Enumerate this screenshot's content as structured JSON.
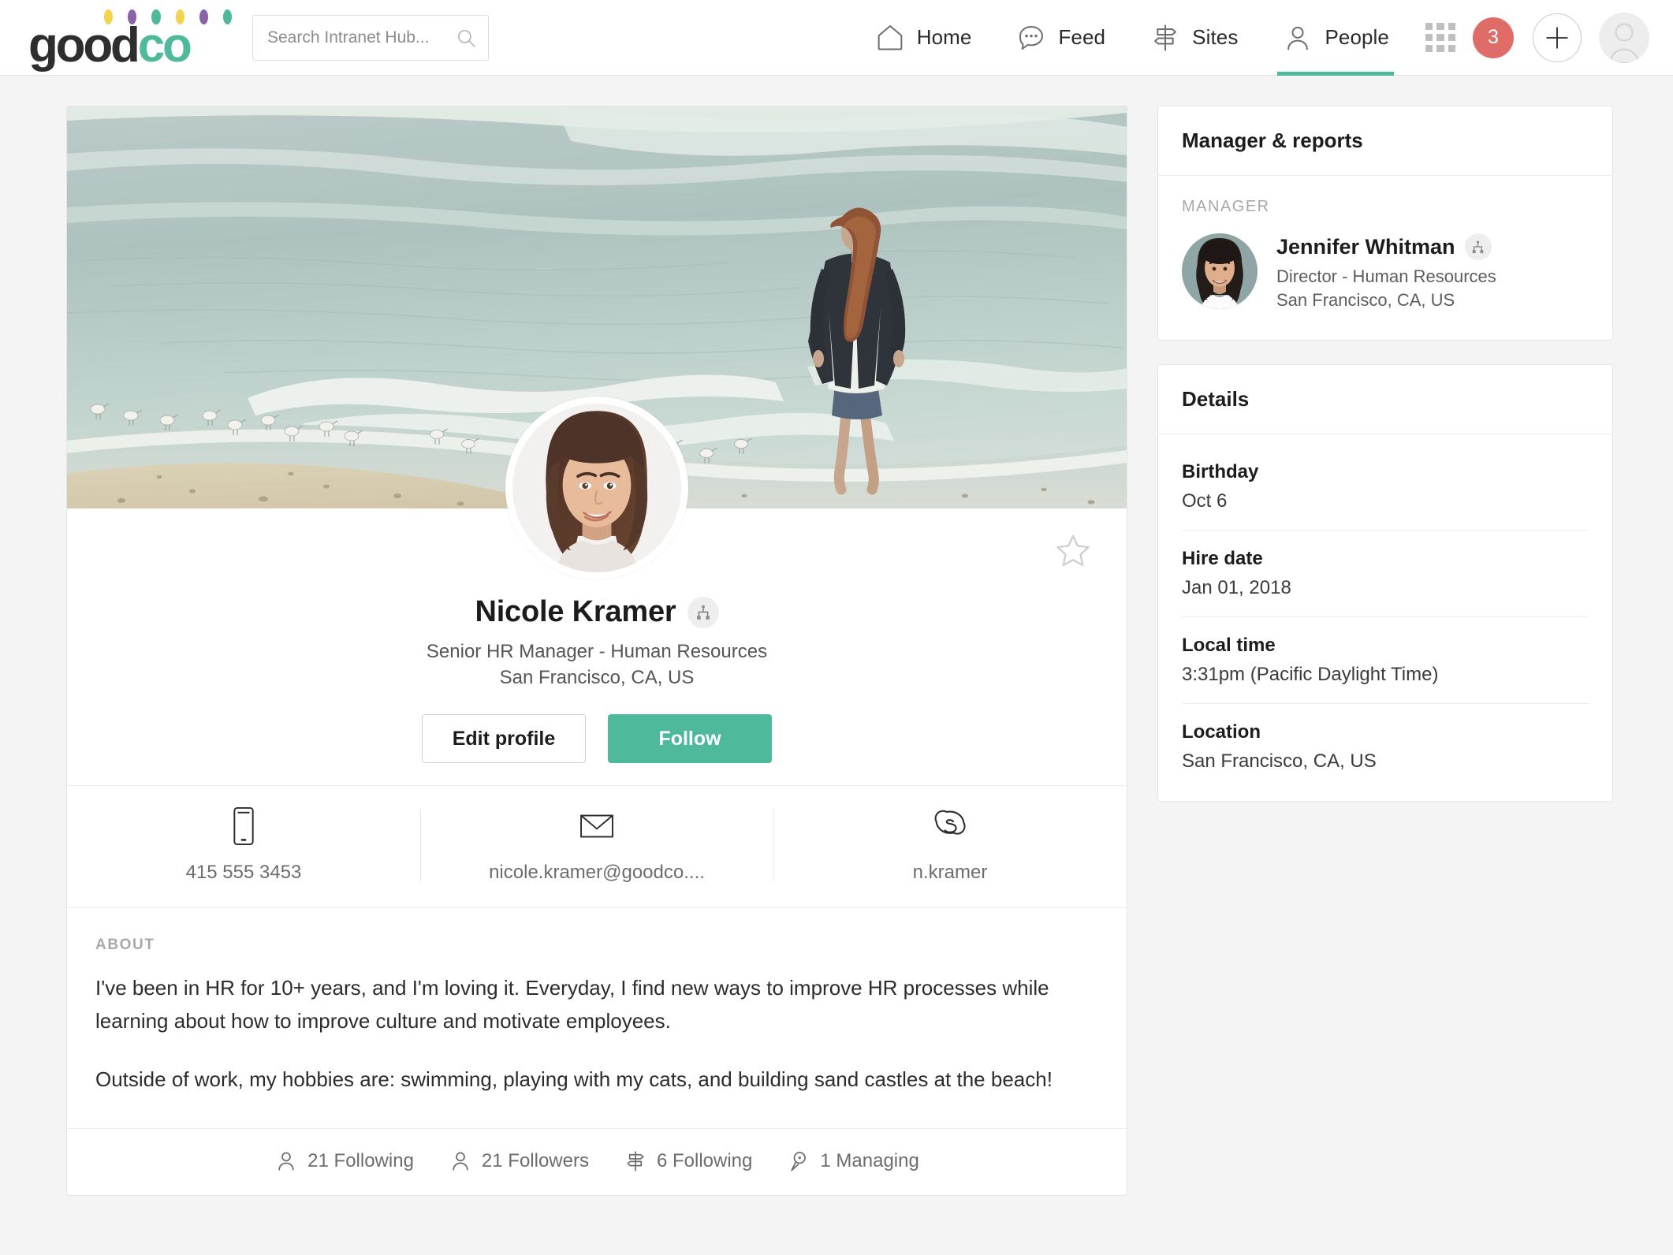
{
  "brand": {
    "name_dark": "good",
    "name_accent": "co",
    "accent_color": "#4fba9b",
    "dot_colors": [
      "#f3d44e",
      "#8b63ab",
      "#4fba9b",
      "#f3d44e",
      "#8b63ab",
      "#4fba9b"
    ]
  },
  "search": {
    "placeholder": "Search Intranet Hub...",
    "value": ""
  },
  "nav": {
    "items": [
      {
        "label": "Home",
        "icon": "home-icon",
        "active": false
      },
      {
        "label": "Feed",
        "icon": "feed-icon",
        "active": false
      },
      {
        "label": "Sites",
        "icon": "sites-icon",
        "active": false
      },
      {
        "label": "People",
        "icon": "people-icon",
        "active": true
      }
    ],
    "apps_icon": "apps-grid-icon",
    "notification_count": "3",
    "notification_color": "#e06c68",
    "create_icon": "plus-icon",
    "account_icon": "account-avatar-icon"
  },
  "profile": {
    "cover_photo_alt": "beach-cover-photo",
    "avatar_alt": "nicole-kramer-avatar",
    "name": "Nicole Kramer",
    "org_chart_icon": "org-chart-icon",
    "title": "Senior HR Manager - Human Resources",
    "location": "San Francisco, CA, US",
    "favorite_icon": "star-outline-icon",
    "buttons": {
      "edit": "Edit profile",
      "follow": "Follow"
    },
    "contacts": [
      {
        "icon": "mobile-phone-icon",
        "value": "415 555 3453"
      },
      {
        "icon": "envelope-icon",
        "value": "nicole.kramer@goodco...."
      },
      {
        "icon": "skype-icon",
        "value": "n.kramer"
      }
    ],
    "about": {
      "label": "ABOUT",
      "paragraphs": [
        "I've been in HR for 10+ years, and I'm loving it. Everyday, I find new ways to improve HR processes while learning about how to improve culture and motivate employees.",
        "Outside of work, my hobbies are: swimming, playing with my cats, and building sand castles at the beach!"
      ]
    },
    "stats": [
      {
        "icon": "person-icon",
        "label": "21 Following"
      },
      {
        "icon": "person-icon",
        "label": "21 Followers"
      },
      {
        "icon": "sites-icon",
        "label": "6 Following"
      },
      {
        "icon": "managing-icon",
        "label": "1 Managing"
      }
    ]
  },
  "sidebar": {
    "manager_panel": {
      "title": "Manager & reports",
      "section_label": "MANAGER",
      "manager": {
        "avatar_alt": "jennifer-whitman-avatar",
        "name": "Jennifer Whitman",
        "org_chart_icon": "org-chart-icon",
        "title": "Director - Human Resources",
        "location": "San Francisco, CA, US"
      }
    },
    "details_panel": {
      "title": "Details",
      "rows": [
        {
          "key": "Birthday",
          "value": "Oct 6"
        },
        {
          "key": "Hire date",
          "value": "Jan 01, 2018"
        },
        {
          "key": "Local time",
          "value": "3:31pm (Pacific Daylight Time)"
        },
        {
          "key": "Location",
          "value": "San Francisco, CA, US"
        }
      ]
    }
  }
}
